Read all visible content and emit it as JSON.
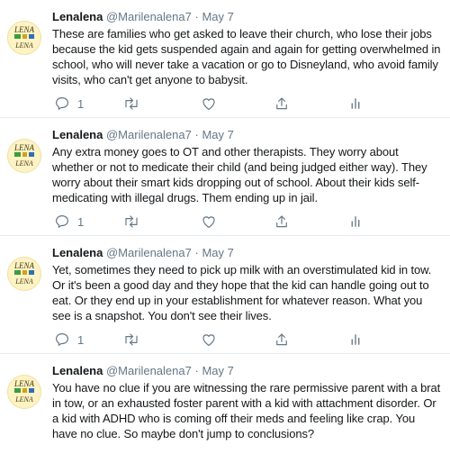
{
  "colors": {
    "text": "#14171a",
    "muted": "#657786",
    "divider": "#e6ecf0",
    "avatar_bg": "#fdf3c4"
  },
  "icons": [
    "reply-icon",
    "retweet-icon",
    "like-icon",
    "share-icon",
    "analytics-icon"
  ],
  "tweets": [
    {
      "name": "Lenalena",
      "handle": "@Marilenalena7",
      "separator": "·",
      "date": "May 7",
      "avatar_text": [
        "LENA",
        "LENA"
      ],
      "text": "These are families who get asked to leave their church, who lose their jobs because the kid gets suspended again and again for getting overwhelmed in school, who will never take a vacation or go to Disneyland, who avoid family visits, who can't get anyone to babysit.",
      "reply_count": "1"
    },
    {
      "name": "Lenalena",
      "handle": "@Marilenalena7",
      "separator": "·",
      "date": "May 7",
      "avatar_text": [
        "LENA",
        "LENA"
      ],
      "text": "Any extra money goes to OT and other therapists. They worry about whether or not to medicate their child (and being judged either way). They worry about their smart kids dropping out of school. About their kids self-medicating with illegal drugs. Them ending up in jail.",
      "reply_count": "1"
    },
    {
      "name": "Lenalena",
      "handle": "@Marilenalena7",
      "separator": "·",
      "date": "May 7",
      "avatar_text": [
        "LENA",
        "LENA"
      ],
      "text": "Yet, sometimes they need to pick up milk with an overstimulated kid in tow. Or it's been a good day and they hope that the kid can handle going out to eat. Or they end up in your establishment for whatever reason. What you see is a snapshot. You don't see their lives.",
      "reply_count": "1"
    },
    {
      "name": "Lenalena",
      "handle": "@Marilenalena7",
      "separator": "·",
      "date": "May 7",
      "avatar_text": [
        "LENA",
        "LENA"
      ],
      "text": "You have no clue if you are witnessing the rare permissive parent with a brat in tow, or an exhausted foster parent with a kid with attachment disorder. Or a kid with ADHD who is coming off their meds and feeling like crap. You have no clue. So maybe don't jump to conclusions?",
      "reply_count": ""
    }
  ]
}
